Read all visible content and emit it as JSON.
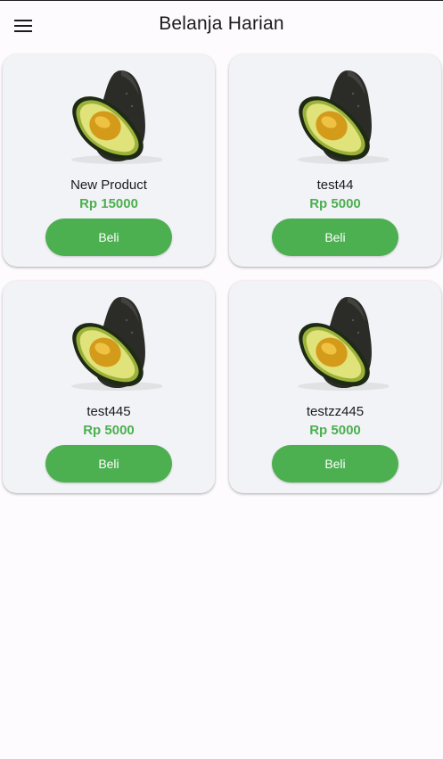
{
  "app_bar": {
    "title": "Belanja Harian",
    "menu_icon": "menu-icon"
  },
  "products": [
    {
      "name": "New Product",
      "price": "Rp 15000",
      "button_label": "Beli",
      "image": "avocado-image"
    },
    {
      "name": "test44",
      "price": "Rp 5000",
      "button_label": "Beli",
      "image": "avocado-image"
    },
    {
      "name": "test445",
      "price": "Rp 5000",
      "button_label": "Beli",
      "image": "avocado-image"
    },
    {
      "name": "testzz445",
      "price": "Rp 5000",
      "button_label": "Beli",
      "image": "avocado-image"
    }
  ],
  "colors": {
    "accent": "#4caf50",
    "card_background": "#f2f3f6",
    "page_background": "#fefbff"
  }
}
